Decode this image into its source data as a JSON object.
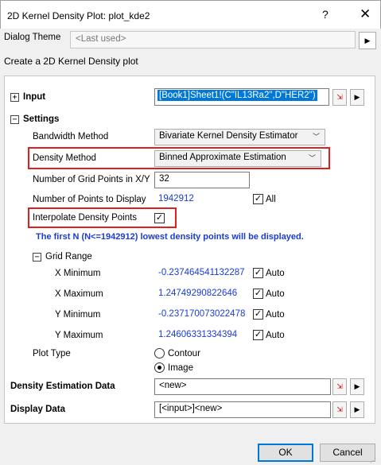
{
  "window": {
    "title": "2D Kernel Density Plot: plot_kde2",
    "help": "?",
    "close": "✕"
  },
  "theme": {
    "label": "Dialog Theme",
    "value": "<Last used>"
  },
  "description": "Create a 2D Kernel Density plot",
  "input": {
    "label": "Input",
    "value": "[Book1]Sheet1!(C\"IL13Ra2\",D\"HER2\")"
  },
  "settings": {
    "label": "Settings",
    "bandwidth": {
      "label": "Bandwidth Method",
      "value": "Bivariate Kernel Density Estimator"
    },
    "density": {
      "label": "Density Method",
      "value": "Binned Approximate Estimation"
    },
    "grid_points": {
      "label": "Number of Grid Points in X/Y",
      "value": "32"
    },
    "points_display": {
      "label": "Number of Points to Display",
      "value": "1942912",
      "all_label": "All",
      "all_checked": true
    },
    "interpolate": {
      "label": "Interpolate Density Points",
      "checked": true
    },
    "note": "The first N (N<=1942912) lowest density points will be displayed.",
    "grid_range": {
      "label": "Grid Range",
      "x_min": {
        "label": "X Minimum",
        "value": "-0.237464541132287",
        "auto": "Auto"
      },
      "x_max": {
        "label": "X Maximum",
        "value": "1.24749290822646",
        "auto": "Auto"
      },
      "y_min": {
        "label": "Y Minimum",
        "value": "-0.237170073022478",
        "auto": "Auto"
      },
      "y_max": {
        "label": "Y Maximum",
        "value": "1.24606331334394",
        "auto": "Auto"
      }
    },
    "plot_type": {
      "label": "Plot Type",
      "contour": "Contour",
      "image": "Image",
      "selected": "Image"
    }
  },
  "density_data": {
    "label": "Density Estimation Data",
    "value": "<new>"
  },
  "display_data": {
    "label": "Display Data",
    "value": "[<input>]<new>"
  },
  "buttons": {
    "ok": "OK",
    "cancel": "Cancel"
  },
  "colors": {
    "accent": "#0078d7",
    "highlight": "#e02020",
    "value_blue": "#1a3bd6"
  }
}
